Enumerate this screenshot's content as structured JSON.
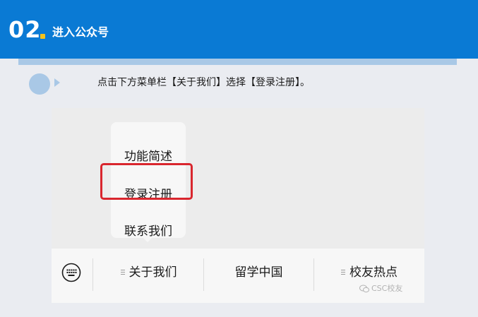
{
  "header": {
    "step_number": "02",
    "title": "进入公众号"
  },
  "instruction": "点击下方菜单栏【关于我们】选择【登录注册】。",
  "popup_menu": {
    "items": [
      "功能简述",
      "登录注册",
      "联系我们"
    ],
    "highlighted_item": "登录注册"
  },
  "menubar": {
    "items": [
      "关于我们",
      "留学中国",
      "校友热点"
    ]
  },
  "watermark": "CSC校友",
  "colors": {
    "header_bg": "#0a7ad4",
    "accent_yellow": "#f4c21b",
    "light_blue": "#a9c8e6",
    "highlight_red": "#d9262e"
  },
  "icons": [
    "keyboard-icon",
    "hamburger-icon",
    "wechat-icon"
  ]
}
